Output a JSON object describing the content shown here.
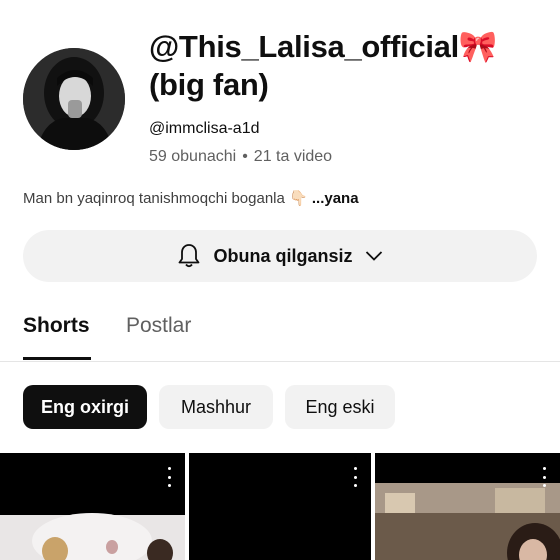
{
  "channel": {
    "title": "@This_Lalisa_official🎀 (big fan)",
    "handle": "@immclisa-a1d",
    "subscribers": "59 obunachi",
    "separator": "•",
    "videos": "21 ta video",
    "description": "Man bn yaqinroq tanishmoqchi boganla 👇🏻",
    "description_more": "...yana"
  },
  "subscribe": {
    "label": "Obuna qilgansiz",
    "bell_icon": "bell-icon",
    "chevron_icon": "chevron-down-icon"
  },
  "tabs": [
    {
      "label": "Shorts",
      "active": true
    },
    {
      "label": "Postlar",
      "active": false
    }
  ],
  "filters": [
    {
      "label": "Eng oxirgi",
      "selected": true
    },
    {
      "label": "Mashhur",
      "selected": false
    },
    {
      "label": "Eng eski",
      "selected": false
    }
  ],
  "colors": {
    "background": "#ffffff",
    "text": "#0f0f0f",
    "secondary_text": "#606060",
    "chip_background": "#f2f2f2",
    "selected_chip": "#0f0f0f"
  }
}
